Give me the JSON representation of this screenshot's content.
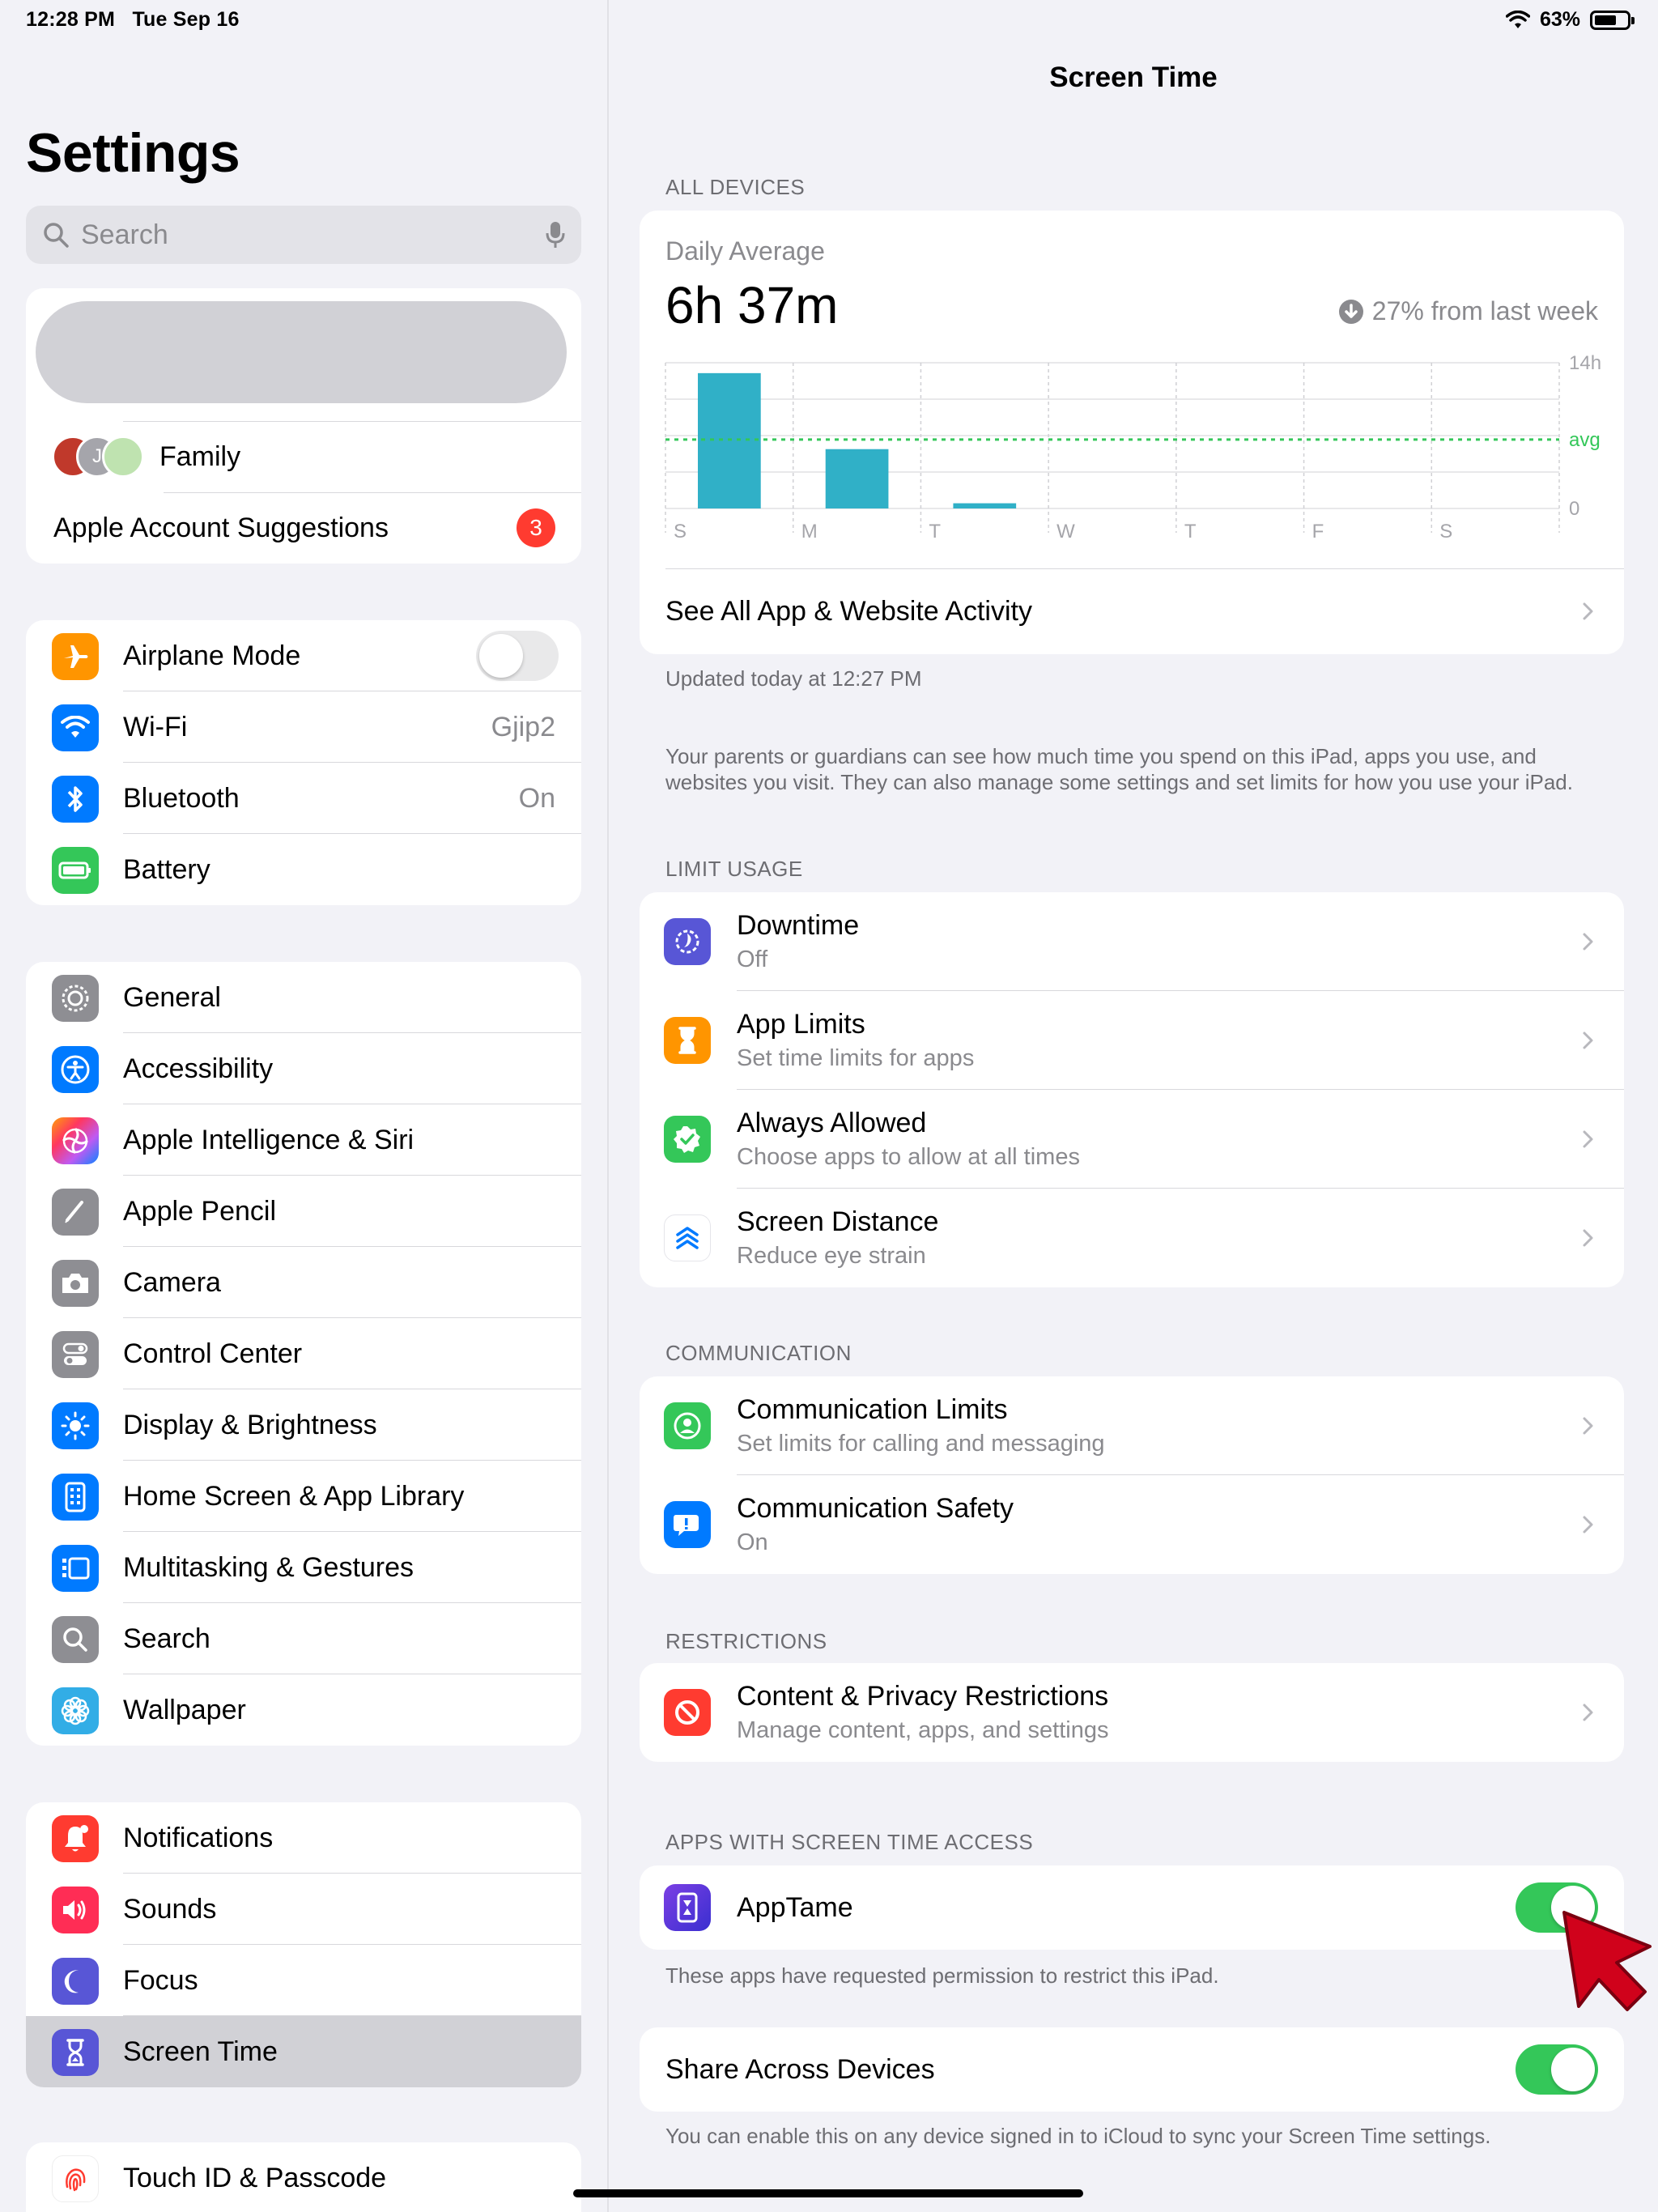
{
  "status": {
    "time": "12:28 PM",
    "date": "Tue Sep 16",
    "battery": "63%"
  },
  "sidebar": {
    "title": "Settings",
    "search_placeholder": "Search",
    "account": {
      "family_label": "Family",
      "avatar_initial": "J",
      "suggestions_label": "Apple Account Suggestions",
      "suggestions_badge": "3"
    },
    "connectivity": [
      {
        "label": "Airplane Mode",
        "value": "",
        "toggle": false,
        "icon": "airplane-icon",
        "color": "#ff9500"
      },
      {
        "label": "Wi-Fi",
        "value": "Gjip2",
        "icon": "wifi-icon",
        "color": "#007aff"
      },
      {
        "label": "Bluetooth",
        "value": "On",
        "icon": "bluetooth-icon",
        "color": "#007aff"
      },
      {
        "label": "Battery",
        "value": "",
        "icon": "battery-icon",
        "color": "#34c759"
      }
    ],
    "system": [
      {
        "label": "General",
        "icon": "gear-icon",
        "color": "#8e8e93"
      },
      {
        "label": "Accessibility",
        "icon": "accessibility-icon",
        "color": "#007aff"
      },
      {
        "label": "Apple Intelligence & Siri",
        "icon": "siri-icon",
        "color": "#bf5af2"
      },
      {
        "label": "Apple Pencil",
        "icon": "pencil-icon",
        "color": "#8e8e93"
      },
      {
        "label": "Camera",
        "icon": "camera-icon",
        "color": "#8e8e93"
      },
      {
        "label": "Control Center",
        "icon": "control-center-icon",
        "color": "#8e8e93"
      },
      {
        "label": "Display & Brightness",
        "icon": "brightness-icon",
        "color": "#007aff"
      },
      {
        "label": "Home Screen & App Library",
        "icon": "home-screen-icon",
        "color": "#007aff"
      },
      {
        "label": "Multitasking & Gestures",
        "icon": "multitasking-icon",
        "color": "#007aff"
      },
      {
        "label": "Search",
        "icon": "search-icon",
        "color": "#8e8e93"
      },
      {
        "label": "Wallpaper",
        "icon": "wallpaper-icon",
        "color": "#32ade6"
      }
    ],
    "alerts": [
      {
        "label": "Notifications",
        "icon": "bell-icon",
        "color": "#ff3b30"
      },
      {
        "label": "Sounds",
        "icon": "speaker-icon",
        "color": "#ff2d55"
      },
      {
        "label": "Focus",
        "icon": "moon-icon",
        "color": "#5856d6"
      },
      {
        "label": "Screen Time",
        "icon": "hourglass-icon",
        "color": "#5856d6",
        "selected": true
      }
    ],
    "security": [
      {
        "label": "Touch ID & Passcode",
        "icon": "fingerprint-icon",
        "color": "#ff3b30"
      }
    ]
  },
  "main": {
    "title": "Screen Time",
    "all_devices_header": "ALL DEVICES",
    "daily_average_label": "Daily Average",
    "daily_average_value": "6h 37m",
    "trend_text": "27% from last week",
    "see_all_label": "See All App & Website Activity",
    "updated_text": "Updated today at 12:27 PM",
    "parents_note": "Your parents or guardians can see how much time you spend on this iPad, apps you use, and websites you visit. They can also manage some settings and set limits for how you use your iPad.",
    "limit_usage_header": "LIMIT USAGE",
    "limit_usage": [
      {
        "title": "Downtime",
        "subtitle": "Off",
        "icon": "downtime-icon",
        "color": "#5856d6"
      },
      {
        "title": "App Limits",
        "subtitle": "Set time limits for apps",
        "icon": "hourglass-icon",
        "color": "#ff9500"
      },
      {
        "title": "Always Allowed",
        "subtitle": "Choose apps to allow at all times",
        "icon": "checkmark-badge-icon",
        "color": "#34c759"
      },
      {
        "title": "Screen Distance",
        "subtitle": "Reduce eye strain",
        "icon": "chevrons-up-icon",
        "color": "#ffffff"
      }
    ],
    "communication_header": "COMMUNICATION",
    "communication": [
      {
        "title": "Communication Limits",
        "subtitle": "Set limits for calling and messaging",
        "icon": "person-circle-icon",
        "color": "#34c759"
      },
      {
        "title": "Communication Safety",
        "subtitle": "On",
        "icon": "message-alert-icon",
        "color": "#007aff"
      }
    ],
    "restrictions_header": "RESTRICTIONS",
    "restrictions": [
      {
        "title": "Content & Privacy Restrictions",
        "subtitle": "Manage content, apps, and settings",
        "icon": "no-sign-icon",
        "color": "#ff3b30"
      }
    ],
    "apps_header": "APPS WITH SCREEN TIME ACCESS",
    "apps": [
      {
        "title": "AppTame",
        "toggle": true,
        "icon": "apptame-icon",
        "color": "#5856d6"
      }
    ],
    "apps_note": "These apps have requested permission to restrict this iPad.",
    "share_label": "Share Across Devices",
    "share_toggle": true,
    "share_note": "You can enable this on any device signed in to iCloud to sync your Screen Time settings."
  },
  "chart_data": {
    "type": "bar",
    "categories": [
      "S",
      "M",
      "T",
      "W",
      "T",
      "F",
      "S"
    ],
    "values": [
      13,
      5.7,
      0.5,
      0,
      0,
      0,
      0
    ],
    "ylim": [
      0,
      14
    ],
    "y_ticks": [
      "14h",
      "avg",
      "0"
    ],
    "average": 6.62,
    "bar_color": "#30b0c7",
    "avg_color": "#34c759",
    "grid": true
  }
}
